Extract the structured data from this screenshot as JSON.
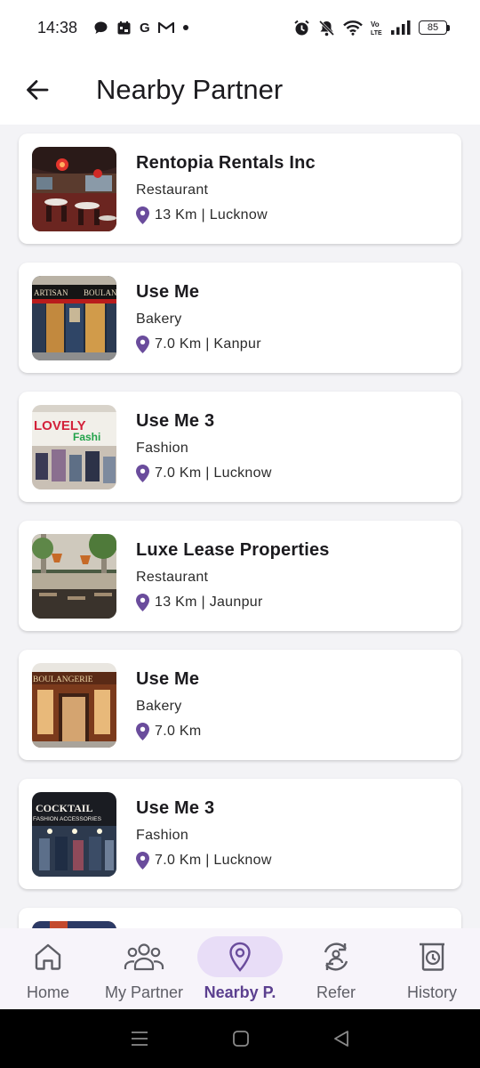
{
  "status_bar": {
    "time": "14:38",
    "app_icons": [
      "chat-bubble-icon",
      "calendar-icon",
      "google-icon",
      "gmail-icon",
      "dot-icon"
    ],
    "right_icons": [
      "alarm-icon",
      "bell-off-icon",
      "wifi-icon",
      "volte-icon",
      "signal-icon"
    ],
    "volte_label": "Vo LTE",
    "battery": "85"
  },
  "app_bar": {
    "title": "Nearby Partner",
    "back_icon": "arrow-left-icon"
  },
  "partners": [
    {
      "name": "Rentopia Rentals Inc",
      "category": "Restaurant",
      "location": "13 Km | Lucknow",
      "image": "restaurant-interior"
    },
    {
      "name": "Use Me",
      "category": "Bakery",
      "location": "7.0 Km | Kanpur",
      "image": "bakery-storefront",
      "sign_left": "ARTISAN",
      "sign_right": "BOULANG"
    },
    {
      "name": "Use Me 3",
      "category": "Fashion",
      "location": "7.0 Km | Lucknow",
      "image": "fashion-store",
      "sign_top": "LOVELY",
      "sign_bottom": "Fashi"
    },
    {
      "name": "Luxe Lease Properties",
      "category": "Restaurant",
      "location": "13 Km | Jaunpur",
      "image": "restaurant-terrace"
    },
    {
      "name": "Use Me",
      "category": "Bakery",
      "location": "7.0 Km",
      "image": "boulangerie-storefront",
      "sign": "BOULANGERIE"
    },
    {
      "name": "Use Me 3",
      "category": "Fashion",
      "location": "7.0 Km | Lucknow",
      "image": "cocktail-fashion-store",
      "sign_top": "COCKTAIL",
      "sign_bottom": "FASHION ACCESSORIES"
    }
  ],
  "bottom_nav": {
    "items": [
      {
        "label": "Home",
        "icon": "home-icon"
      },
      {
        "label": "My Partner",
        "icon": "people-icon"
      },
      {
        "label": "Nearby P.",
        "icon": "location-pin-icon",
        "active": true
      },
      {
        "label": "Refer",
        "icon": "refer-icon"
      },
      {
        "label": "History",
        "icon": "history-icon"
      }
    ]
  },
  "colors": {
    "accent": "#6a4c9c",
    "active_pill": "#e8ddf7",
    "background": "#f3f3f6"
  }
}
